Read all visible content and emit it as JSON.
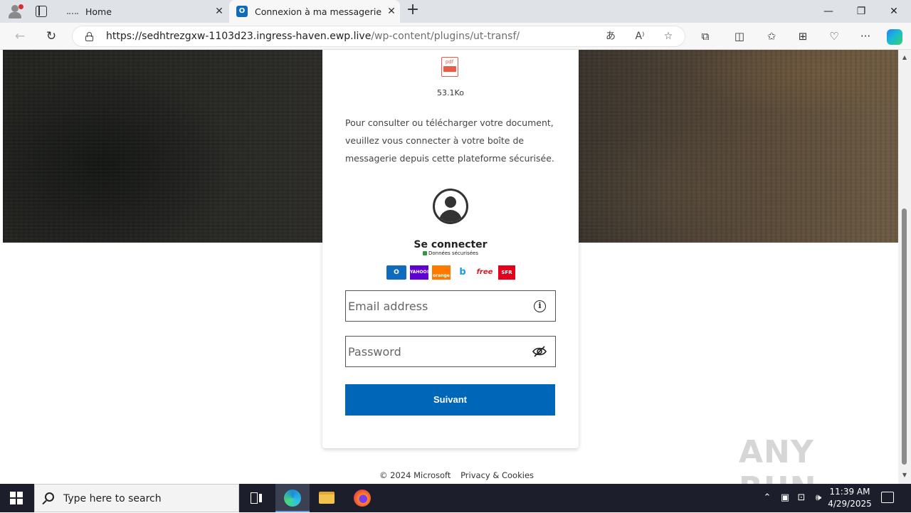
{
  "browser": {
    "tabs": [
      {
        "label": "Home",
        "favicon": "home-favicon"
      },
      {
        "label": "Connexion à ma messagerie - Ur",
        "favicon": "outlook-favicon",
        "active": true
      }
    ],
    "favicon_letter": "O",
    "url_host": "https://sedhtrezgxw-1103d23.ingress-haven.ewp.live",
    "url_path": "/wp-content/plugins/ut-transf/",
    "icons": {
      "back": "back-arrow-icon",
      "refresh": "refresh-icon",
      "translate": "translate-icon",
      "read_aloud": "read-aloud-icon",
      "favorite": "star-icon",
      "extensions": "puzzle-icon",
      "split": "split-screen-icon",
      "favorites": "favorites-icon",
      "collections": "collections-icon",
      "performance": "heart-pulse-icon",
      "more": "ellipsis-icon",
      "copilot": "copilot-icon"
    }
  },
  "card": {
    "pdf_label": "pdf",
    "file_size": "53.1Ko",
    "description": "Pour consulter ou télécharger votre document, veuillez vous connecter à votre boîte de messagerie depuis cette plateforme sécurisée.",
    "signin_title": "Se connecter",
    "secure_label": "Données sécurisées",
    "providers": [
      "Outlook",
      "Yahoo!",
      "orange",
      "Bouygues",
      "free",
      "SFR"
    ],
    "provider_text": {
      "outlook": "O",
      "yahoo": "YAHOO!",
      "orange": "orange",
      "bouygues": "b",
      "free": "free",
      "sfr": "SFR"
    },
    "email_placeholder": "Email address",
    "password_placeholder": "Password",
    "info_glyph": "i",
    "next_button": "Suivant"
  },
  "footer": {
    "copyright": "© 2024 Microsoft",
    "privacy": "Privacy & Cookies"
  },
  "watermark": "ANY RUN",
  "taskbar": {
    "search_placeholder": "Type here to search",
    "time": "11:39 AM",
    "date": "4/29/2025"
  },
  "colors": {
    "primary_button": "#0067b8",
    "taskbar": "#1c1f2b"
  }
}
